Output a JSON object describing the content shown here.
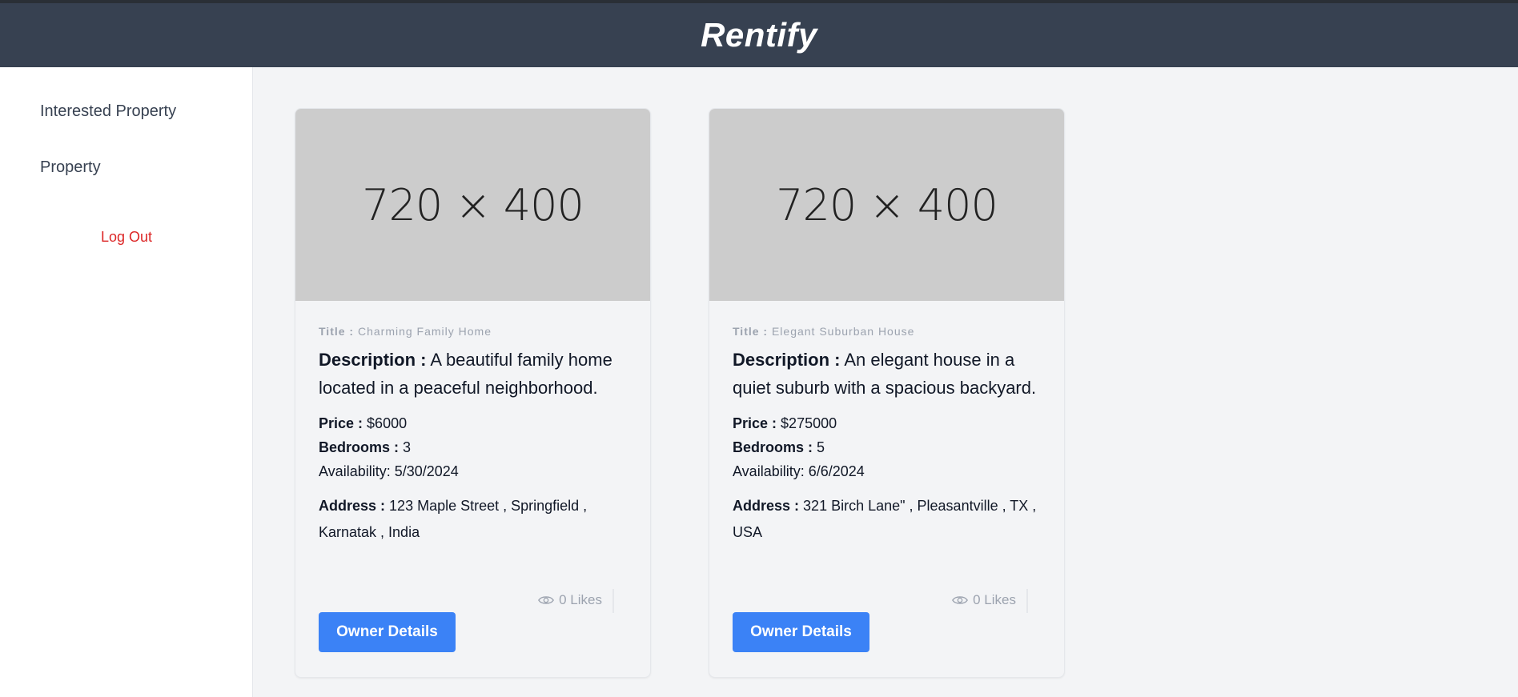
{
  "header": {
    "brand": "Rentify"
  },
  "sidebar": {
    "items": [
      {
        "label": "Interested Property"
      },
      {
        "label": "Property"
      }
    ],
    "logout_label": "Log Out"
  },
  "labels": {
    "title": "Title :",
    "description": "Description :",
    "price": "Price :",
    "bedrooms": "Bedrooms :",
    "address": "Address :",
    "owner_button": "Owner Details",
    "likes_suffix": "Likes"
  },
  "properties": [
    {
      "image_placeholder": "720 × 400",
      "title": "Charming Family Home",
      "description": "A beautiful family home located in a peaceful neighborhood.",
      "price": "$6000",
      "bedrooms": "3",
      "availability": "Availability: 5/30/2024",
      "address": "123 Maple Street , Springfield , Karnatak , India",
      "likes": "0 Likes"
    },
    {
      "image_placeholder": "720 × 400",
      "title": "Elegant Suburban House",
      "description": "An elegant house in a quiet suburb with a spacious backyard.",
      "price": "$275000",
      "bedrooms": "5",
      "availability": "Availability: 6/6/2024",
      "address": "321 Birch Lane\" , Pleasantville , TX , USA",
      "likes": "0 Likes"
    }
  ],
  "colors": {
    "header_bg": "#374151",
    "button_bg": "#3b82f6",
    "logout": "#dc2626",
    "image_placeholder_bg": "#cccccc"
  },
  "icons": {
    "likes_icon": "eye-icon"
  }
}
